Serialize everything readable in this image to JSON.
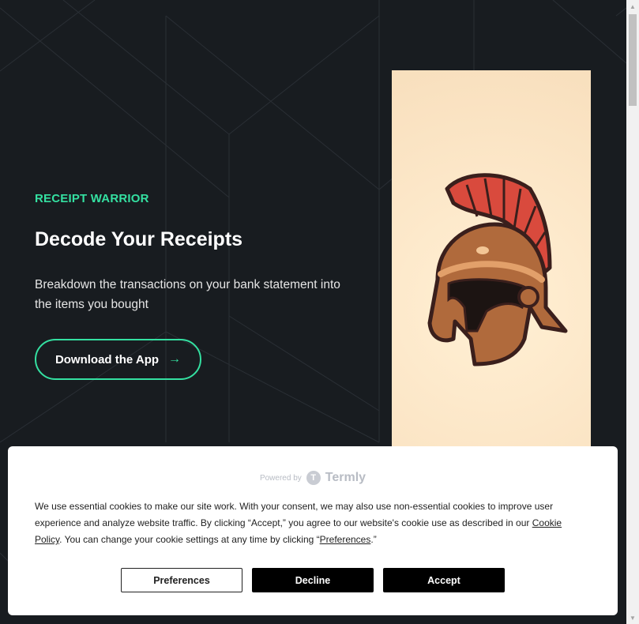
{
  "hero": {
    "eyebrow": "RECEIPT WARRIOR",
    "title": "Decode Your Receipts",
    "description": "Breakdown the transactions on your bank statement into the items you bought",
    "cta_label": "Download the App",
    "cta_icon": "arrow-right-icon",
    "image": "spartan-helmet-illustration"
  },
  "cookie_banner": {
    "powered_by": "Powered by",
    "brand": "Termly",
    "text_before": "We use essential cookies to make our site work. With your consent, we may also use non-essential cookies to improve user experience and analyze website traffic. By clicking “Accept,” you agree to our website's cookie use as described in our ",
    "cookie_policy_link": "Cookie Policy",
    "text_middle": ". You can change your cookie settings at any time by clicking “",
    "preferences_link": "Preferences",
    "text_after": ".”",
    "buttons": {
      "preferences": "Preferences",
      "decline": "Decline",
      "accept": "Accept"
    }
  },
  "colors": {
    "accent": "#34e0a1",
    "background": "#181c20",
    "helmet_crest": "#d94a3d",
    "helmet_bronze": "#b06a3c"
  }
}
